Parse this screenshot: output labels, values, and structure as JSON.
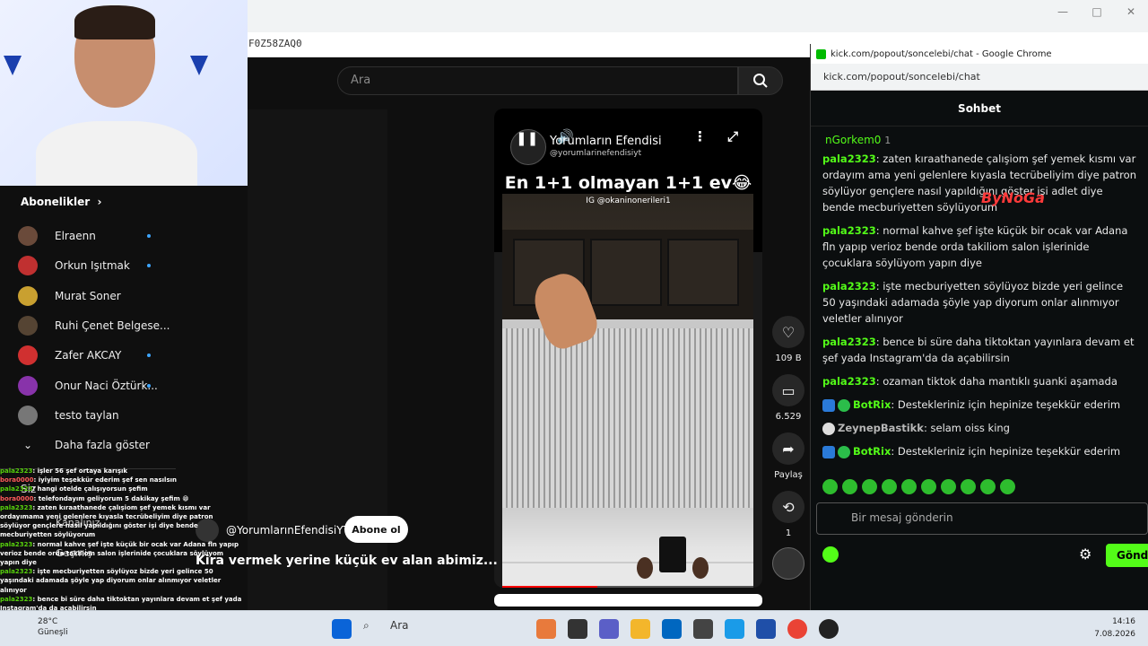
{
  "browser": {
    "url_fragment": "F0Z58ZAQ0"
  },
  "youtube": {
    "search_placeholder": "Ara",
    "sidebar": {
      "subscriptions_title": "Abonelikler",
      "items": [
        {
          "label": "Elraenn",
          "dot": true,
          "color": "#6a4a3a"
        },
        {
          "label": "Orkun Işıtmak",
          "dot": true,
          "color": "#c03030"
        },
        {
          "label": "Murat Soner",
          "dot": false,
          "color": "#c9a030"
        },
        {
          "label": "Ruhi Çenet Belgese...",
          "dot": false,
          "color": "#554433"
        },
        {
          "label": "Zafer AKCAY",
          "dot": true,
          "color": "#d03030"
        },
        {
          "label": "Onur Naci Öztürk...",
          "dot": true,
          "color": "#8833aa"
        },
        {
          "label": "testo taylan",
          "dot": false,
          "color": "#777777"
        }
      ],
      "show_more": "Daha fazla göster",
      "you_label": "Siz",
      "channel_label": "Kanalınız",
      "history_label": "Geçmiş"
    },
    "short": {
      "title": "En 1+1 olmayan 1+1 ev😂",
      "ig_tag": "IG @okaninonerileri1",
      "channel_name": "Yorumların Efendisi",
      "channel_handle": "@yorumlarinefendisiyt",
      "progress": 0.38
    },
    "actions": {
      "likes": "109 B",
      "comments": "6.529",
      "share": "Paylaş",
      "remix": "1"
    },
    "channel_line": "@YorumlarınEfendisiYT",
    "subscribe": "Abone ol",
    "video_title": "Kira vermek yerine küçük ev alan abimiz..."
  },
  "overlay_chat": [
    {
      "user": "pala2323",
      "text": ": işler 56 şef ortaya karışık"
    },
    {
      "user": "bora0000",
      "text": ": iyiyim teşekkür ederim şef sen nasılsın"
    },
    {
      "user": "pala2323",
      "text": ": hangi otelde çalışıyorsun şefim"
    },
    {
      "user": "bora0000",
      "text": ": telefondayım geliyorum 5 dakikay şefim 😁"
    },
    {
      "user": "pala2323",
      "text": ": zaten kıraathanede çalışiom şef yemek kısmı var ordayımama yeni gelenlere kıyasla tecrübeliyim diye patron söylüyor gençlere nasıl yapıldığını göster işi diye bende mecburiyetten söylüyorum"
    },
    {
      "user": "pala2323",
      "text": ": normal kahve şef işte küçük bir ocak var Adana fln yapıp verioz bende orda takiliom salon işlerinide çocuklara söylüyom yapın diye"
    },
    {
      "user": "pala2323",
      "text": ": işte mecburiyetten söylüyoz bizde yeri gelince 50 yaşındaki adamada şöyle yap diyorum onlar alınmıyor veletler alınıyor"
    },
    {
      "user": "pala2323",
      "text": ": bence bi süre daha tiktoktan yayınlara devam et şef yada Instagram'da da açabilirsin"
    }
  ],
  "kick": {
    "window_title": "kick.com/popout/soncelebi/chat - Google Chrome",
    "url": "kick.com/popout/soncelebi/chat",
    "header": "Sohbet",
    "pinned_user": "nGorkem0",
    "pinned_count": "1",
    "messages": [
      {
        "user": "pala2323",
        "text": "zaten kıraathanede çalışiom şef yemek kısmı var ordayım ama yeni gelenlere kıyasla tecrübeliyim diye patron söylüyor gençlere nasıl yapıldığını göster işi adlet diye bende mecburiyetten söylüyorum"
      },
      {
        "user": "pala2323",
        "text": "normal kahve şef işte küçük bir ocak var Adana fln yapıp verioz bende orda takiliom salon işlerinide çocuklara söylüyom yapın diye"
      },
      {
        "user": "pala2323",
        "text": "işte mecburiyetten söylüyoz bizde yeri gelince 50 yaşındaki adamada şöyle yap diyorum onlar alınmıyor veletler alınıyor"
      },
      {
        "user": "pala2323",
        "text": "bence bi süre daha tiktoktan yayınlara devam et şef yada Instagram'da da açabilirsin"
      },
      {
        "user": "pala2323",
        "text": "ozaman tiktok daha mantıklı şuanki aşamada"
      },
      {
        "user": "BotRix",
        "text": "Destekleriniz için hepinize teşekkür ederim",
        "bot": true
      },
      {
        "user": "ZeynepBastikk",
        "text": "selam oiss king",
        "sub": true
      },
      {
        "user": "BotRix",
        "text": "Destekleriniz için hepinize teşekkür ederim",
        "bot": true
      }
    ],
    "watermark": "ByNoGa",
    "input_placeholder": "Bir mesaj gönderin",
    "send": "Gönde"
  },
  "taskbar": {
    "weather_temp": "28°C",
    "weather_desc": "Güneşli",
    "search": "Ara",
    "time": "14:16",
    "date": "7.08.2026"
  }
}
